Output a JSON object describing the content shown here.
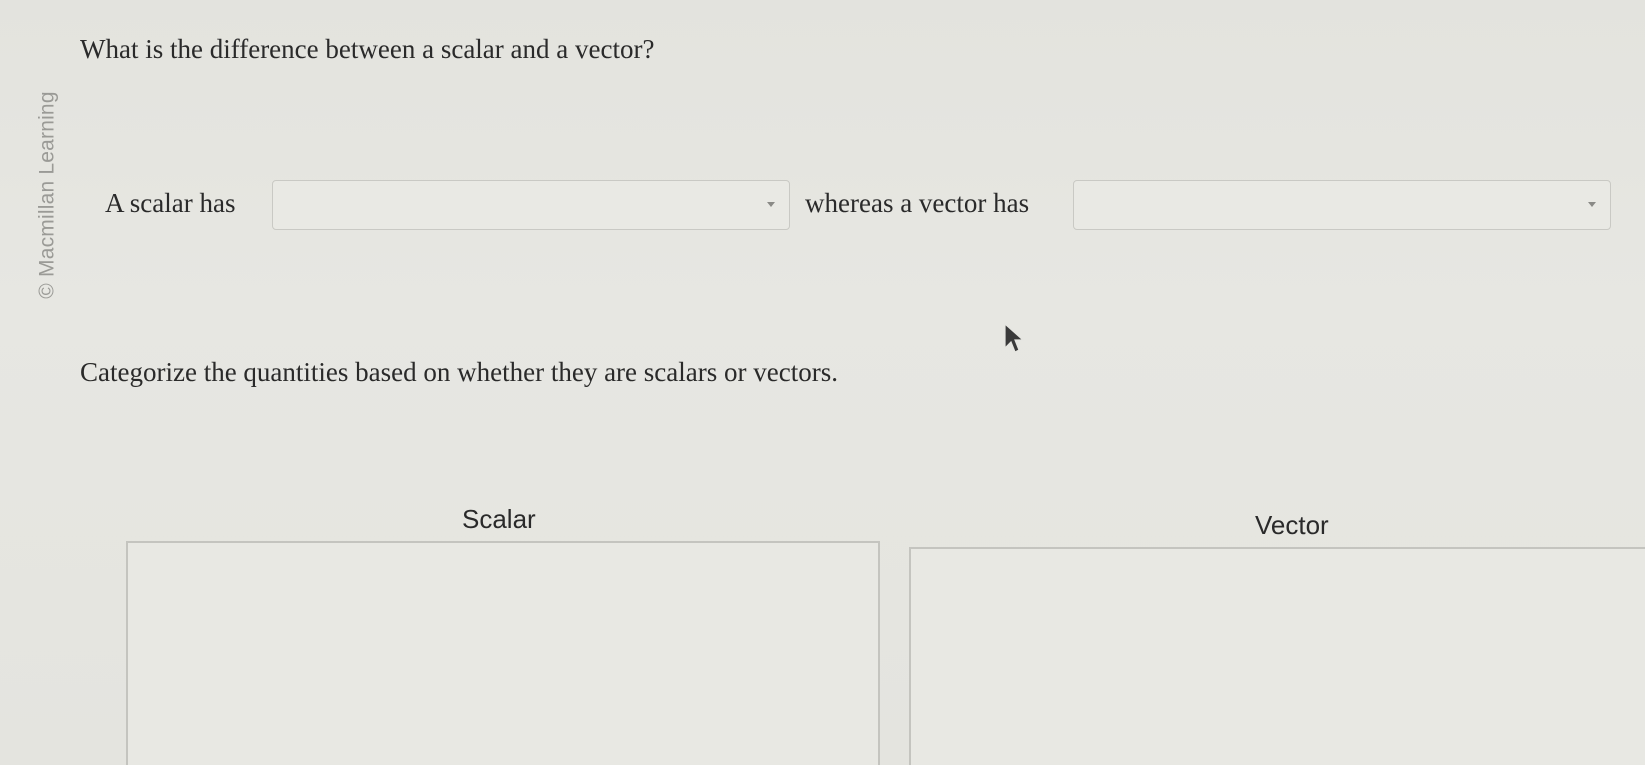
{
  "copyright": "© Macmillan Learning",
  "question": "What is the difference between a scalar and a vector?",
  "sentence": {
    "part1": "A scalar has",
    "dropdown1": {
      "value": ""
    },
    "part2": "whereas a vector has",
    "dropdown2": {
      "value": ""
    }
  },
  "instruction": "Categorize the quantities based on whether they are scalars or vectors.",
  "bins": {
    "scalar_label": "Scalar",
    "vector_label": "Vector"
  },
  "icons": {
    "dropdown_chevron": "chevron-down-icon",
    "cursor": "mouse-pointer-icon"
  }
}
